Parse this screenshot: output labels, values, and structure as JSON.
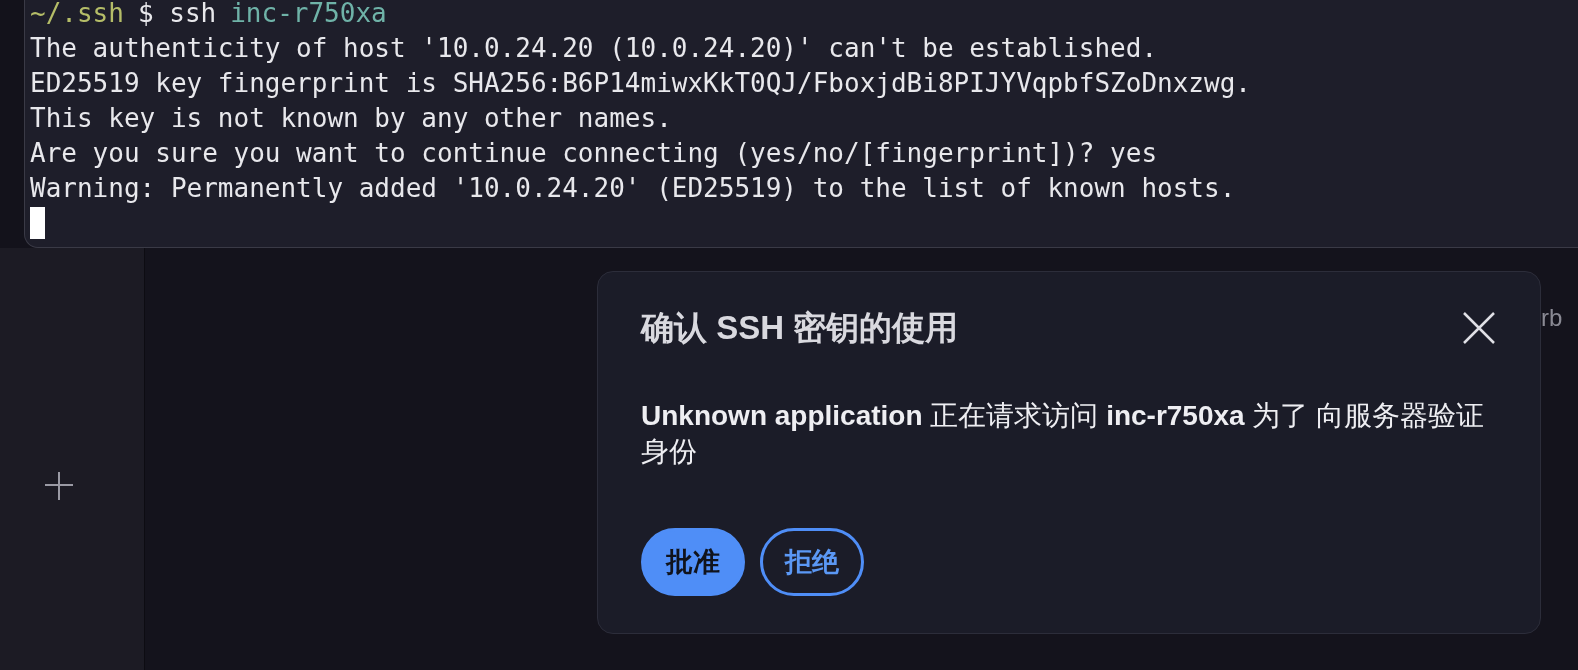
{
  "terminal": {
    "prompt": [
      {
        "kind": "path",
        "text": "~/.ssh"
      },
      {
        "kind": "plain",
        "text": "$ ssh"
      },
      {
        "kind": "arg",
        "text": "inc-r750xa"
      }
    ],
    "lines": [
      "The authenticity of host '10.0.24.20 (10.0.24.20)' can't be established.",
      "ED25519 key fingerprint is SHA256:B6P14miwxKkT0QJ/FboxjdBi8PIJYVqpbfSZoDnxzwg.",
      "This key is not known by any other names.",
      "Are you sure you want to continue connecting (yes/no/[fingerprint])? yes",
      "Warning: Permanently added '10.0.24.20' (ED25519) to the list of known hosts."
    ],
    "cursor": true
  },
  "background": {
    "partial_text": "rb"
  },
  "dialog": {
    "title": "确认 SSH 密钥的使用",
    "message": "**Unknown application** 正在请求访问 **inc-r750xa** 为了 向服务器验证身份",
    "buttons": [
      {
        "kind": "primary",
        "label": "批准"
      },
      {
        "kind": "outline",
        "label": "拒绝"
      }
    ]
  }
}
